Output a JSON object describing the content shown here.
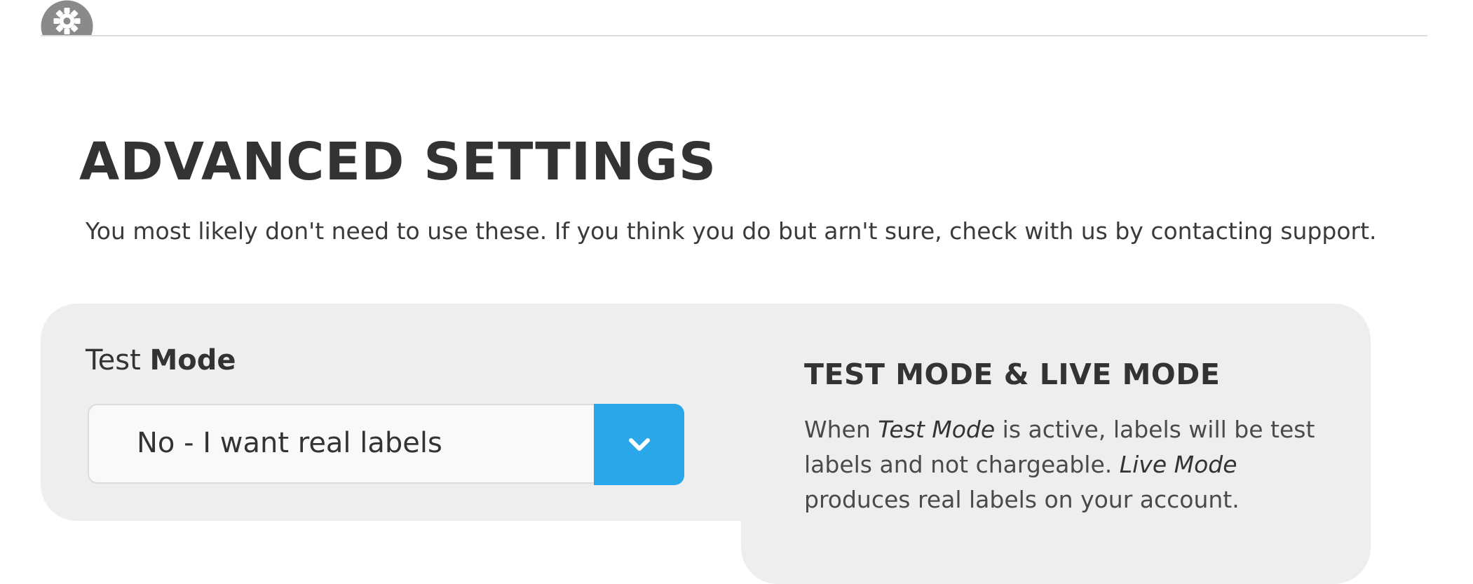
{
  "header": {
    "settings_icon": "gear-icon"
  },
  "page": {
    "title": "ADVANCED SETTINGS",
    "subtitle": "You most likely don't need to use these. If you think you do but arn't sure, check with us by contacting support."
  },
  "test_mode": {
    "label_prefix": "Test",
    "label_strong": "Mode",
    "selected_value": "No - I want real labels",
    "dropdown_icon": "chevron-down-icon"
  },
  "info": {
    "title": "TEST MODE & LIVE MODE",
    "text_1": "When ",
    "term_test": "Test Mode",
    "text_2": " is active, labels will be test labels and not chargeable. ",
    "term_live": "Live Mode",
    "text_3": " produces real labels on your account."
  },
  "colors": {
    "accent": "#2aa7e8",
    "panel": "#eeeeee",
    "text": "#333333"
  }
}
